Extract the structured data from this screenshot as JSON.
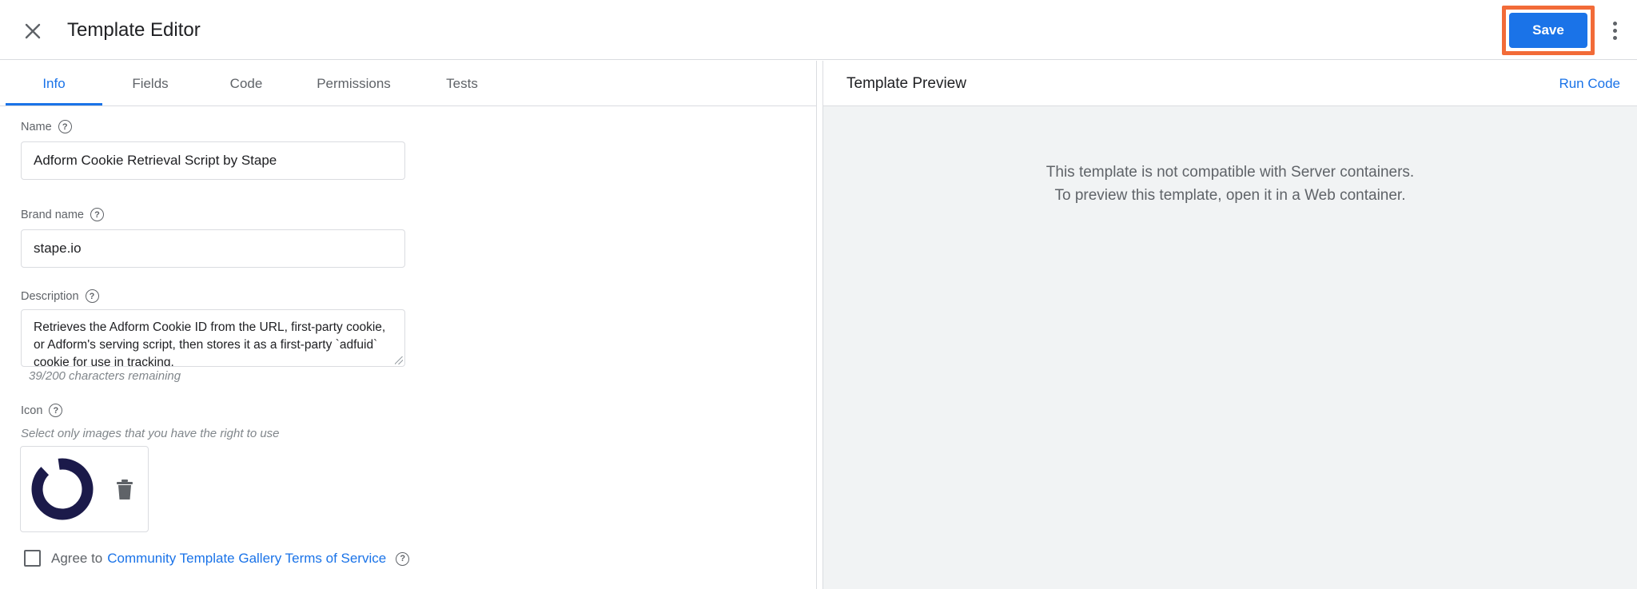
{
  "header": {
    "title": "Template Editor",
    "save_label": "Save"
  },
  "tabs": [
    {
      "label": "Info",
      "active": true
    },
    {
      "label": "Fields",
      "active": false
    },
    {
      "label": "Code",
      "active": false
    },
    {
      "label": "Permissions",
      "active": false
    },
    {
      "label": "Tests",
      "active": false
    }
  ],
  "info": {
    "name_label": "Name",
    "name_value": "Adform Cookie Retrieval Script by Stape",
    "brand_label": "Brand name",
    "brand_value": "stape.io",
    "description_label": "Description",
    "description_value": "Retrieves the Adform Cookie ID from the URL, first-party cookie, or Adform's serving script, then stores it as a first-party `adfuid` cookie for use in tracking.",
    "chars_remaining": "39/200 characters remaining",
    "icon_label": "Icon",
    "icon_hint": "Select only images that you have the right to use",
    "agree_prefix": "Agree to",
    "agree_link": "Community Template Gallery Terms of Service",
    "help_glyph": "?"
  },
  "preview": {
    "title": "Template Preview",
    "run_code_label": "Run Code",
    "message_line1": "This template is not compatible with Server containers.",
    "message_line2": "To preview this template, open it in a Web container."
  },
  "colors": {
    "accent": "#1a73e8",
    "highlight": "#f26b38",
    "logo": "#1b1a4a"
  },
  "icons": [
    "close-icon",
    "kebab-menu-icon",
    "help-icon",
    "trash-icon",
    "stape-logo-icon"
  ]
}
